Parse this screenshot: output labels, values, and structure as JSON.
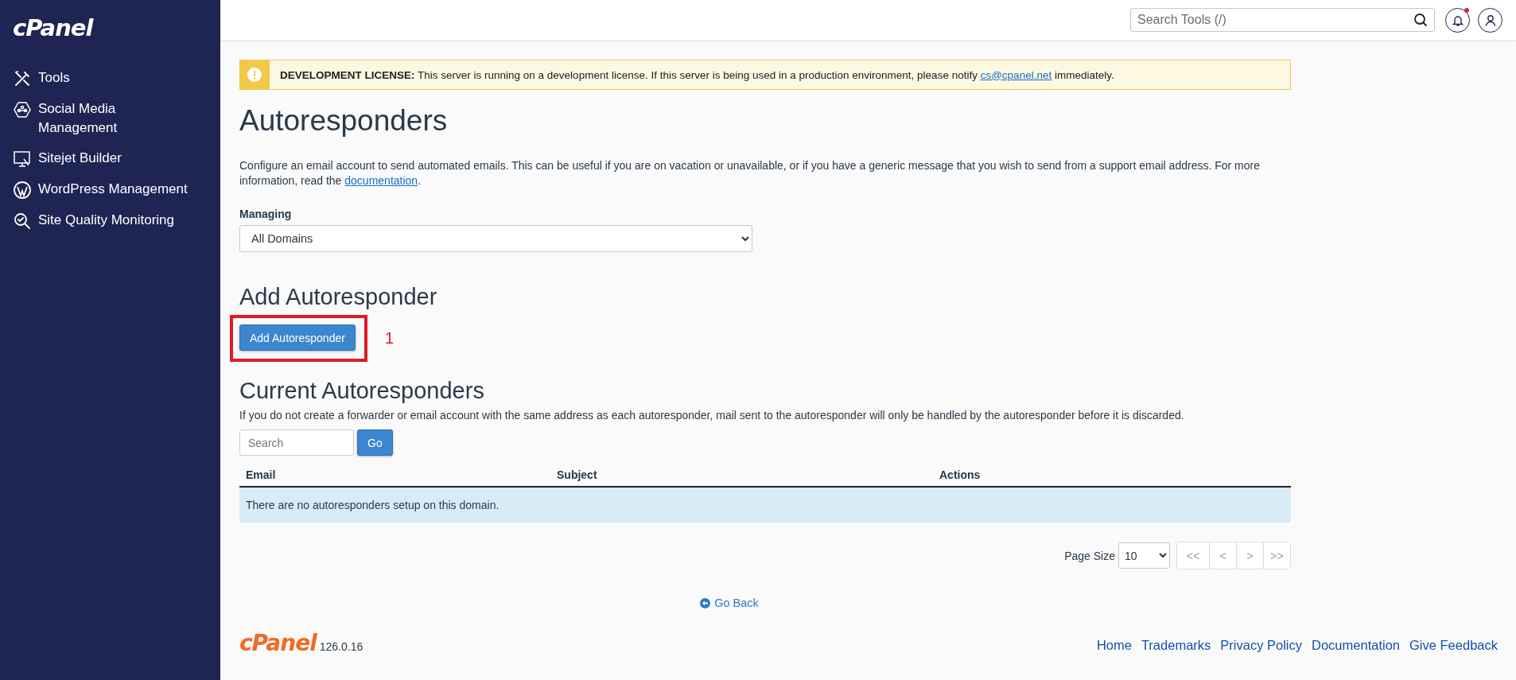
{
  "sidebar": {
    "logo": "cPanel",
    "items": [
      {
        "label": "Tools"
      },
      {
        "label": "Social Media Management"
      },
      {
        "label": "Sitejet Builder"
      },
      {
        "label": "WordPress Management"
      },
      {
        "label": "Site Quality Monitoring"
      }
    ]
  },
  "topbar": {
    "search": {
      "placeholder": "Search Tools (/)"
    },
    "notifications": {
      "unread": true
    }
  },
  "banner": {
    "title": "DEVELOPMENT LICENSE:",
    "text": "This server is running on a development license. If this server is being used in a production environment, please notify",
    "link": "cs@cpanel.net",
    "after": "immediately."
  },
  "page": {
    "title": "Autoresponders",
    "description": "Configure an email account to send automated emails. This can be useful if you are on vacation or unavailable, or if you have a generic message that you wish to send from a support email address. For more information, read the",
    "description_link": "documentation",
    "description_end": "."
  },
  "managing": {
    "label": "Managing",
    "value": "All Domains"
  },
  "add_section": {
    "title": "Add Autoresponder",
    "button": "Add Autoresponder",
    "callout": "1"
  },
  "current_section": {
    "title": "Current Autoresponders",
    "note": "If you do not create a forwarder or email account with the same address as each autoresponder, mail sent to the autoresponder will only be handled by the autoresponder before it is discarded.",
    "search": {
      "placeholder": "Search"
    },
    "go_button": "Go"
  },
  "table": {
    "columns": [
      "Email",
      "Subject",
      "Actions"
    ],
    "empty_message": "There are no autoresponders setup on this domain."
  },
  "pagination": {
    "page_size_label": "Page Size",
    "page_size": "10",
    "buttons": [
      {
        "label": "<<",
        "disabled": true
      },
      {
        "label": "<",
        "disabled": true
      },
      {
        "label": ">",
        "disabled": true
      },
      {
        "label": ">>",
        "disabled": true
      }
    ]
  },
  "go_back": "Go Back",
  "footer": {
    "logo": "cPanel",
    "version": "126.0.16",
    "links": [
      "Home",
      "Trademarks",
      "Privacy Policy",
      "Documentation",
      "Give Feedback"
    ]
  }
}
